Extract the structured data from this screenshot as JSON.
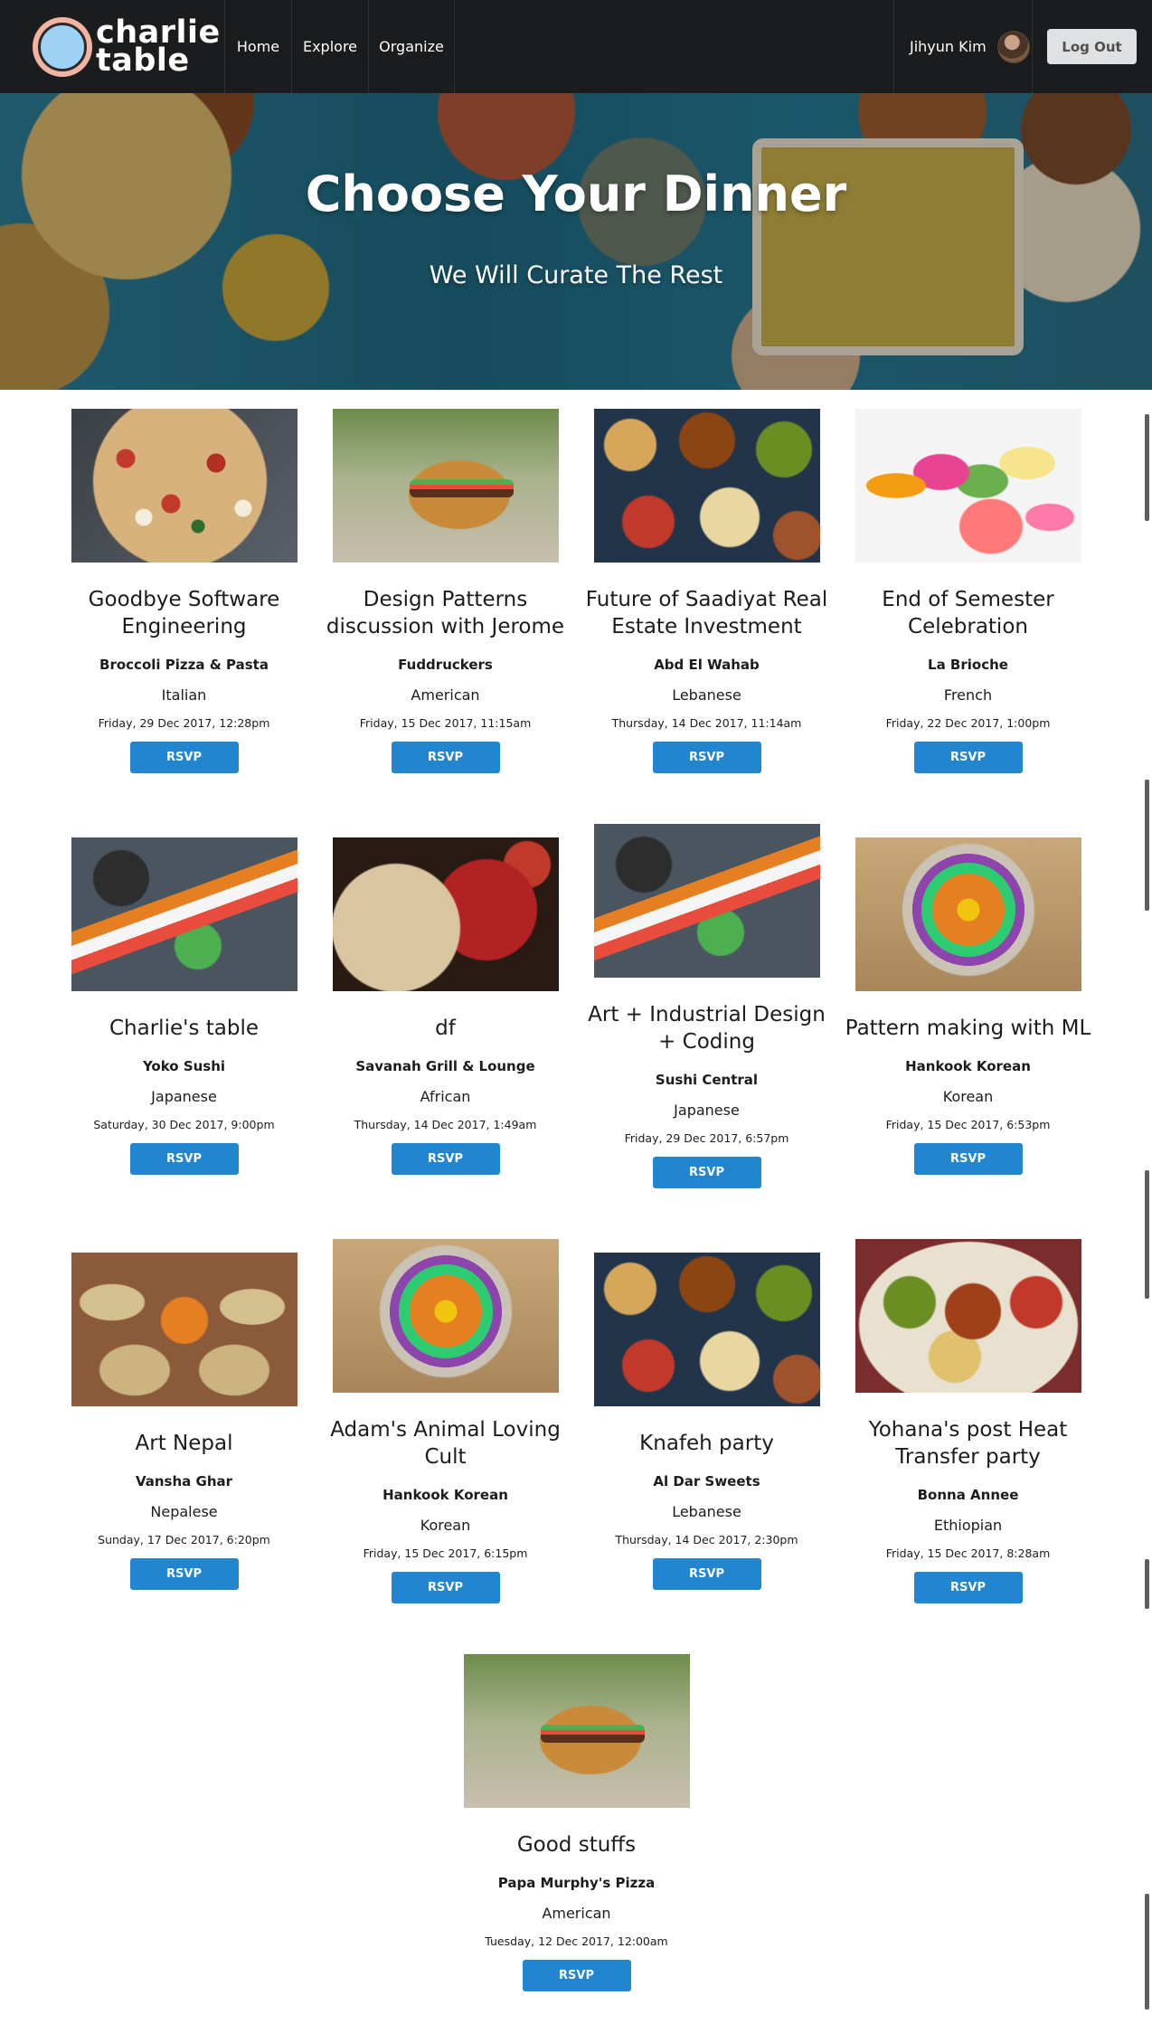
{
  "nav": {
    "logo_line1": "charlie",
    "logo_line2": "table",
    "items": [
      "Home",
      "Explore",
      "Organize"
    ],
    "user_name": "Jihyun Kim",
    "logout_label": "Log Out"
  },
  "hero": {
    "title": "Choose Your Dinner",
    "subtitle": "We Will Curate The Rest"
  },
  "accent_color": "#2185d0",
  "events": [
    {
      "title": "Goodbye Software Engineering",
      "restaurant": "Broccoli Pizza & Pasta",
      "cuisine": "Italian",
      "date": "Friday, 29 Dec 2017, 12:28pm",
      "rsvp": "RSVP",
      "image": "pizza"
    },
    {
      "title": "Design Patterns discussion with Jerome",
      "restaurant": "Fuddruckers",
      "cuisine": "American",
      "date": "Friday, 15 Dec 2017, 11:15am",
      "rsvp": "RSVP",
      "image": "burger"
    },
    {
      "title": "Future of Saadiyat Real Estate Investment",
      "restaurant": "Abd El Wahab",
      "cuisine": "Lebanese",
      "date": "Thursday, 14 Dec 2017, 11:14am",
      "rsvp": "RSVP",
      "image": "mezze"
    },
    {
      "title": "End of Semester Celebration",
      "restaurant": "La Brioche",
      "cuisine": "French",
      "date": "Friday, 22 Dec 2017, 1:00pm",
      "rsvp": "RSVP",
      "image": "macaron"
    },
    {
      "title": "Charlie's table",
      "restaurant": "Yoko Sushi",
      "cuisine": "Japanese",
      "date": "Saturday, 30 Dec 2017, 9:00pm",
      "rsvp": "RSVP",
      "image": "sushi"
    },
    {
      "title": "df",
      "restaurant": "Savanah Grill & Lounge",
      "cuisine": "African",
      "date": "Thursday, 14 Dec 2017, 1:49am",
      "rsvp": "RSVP",
      "image": "rice"
    },
    {
      "title": "Art + Industrial Design + Coding",
      "restaurant": "Sushi Central",
      "cuisine": "Japanese",
      "date": "Friday, 29 Dec 2017, 6:57pm",
      "rsvp": "RSVP",
      "image": "sushi"
    },
    {
      "title": "Pattern making with ML",
      "restaurant": "Hankook Korean",
      "cuisine": "Korean",
      "date": "Friday, 15 Dec 2017, 6:53pm",
      "rsvp": "RSVP",
      "image": "bibimbap"
    },
    {
      "title": "Art Nepal",
      "restaurant": "Vansha Ghar",
      "cuisine": "Nepalese",
      "date": "Sunday, 17 Dec 2017, 6:20pm",
      "rsvp": "RSVP",
      "image": "dumplings"
    },
    {
      "title": "Adam's Animal Loving Cult",
      "restaurant": "Hankook Korean",
      "cuisine": "Korean",
      "date": "Friday, 15 Dec 2017, 6:15pm",
      "rsvp": "RSVP",
      "image": "bibimbap"
    },
    {
      "title": "Knafeh party",
      "restaurant": "Al Dar Sweets",
      "cuisine": "Lebanese",
      "date": "Thursday, 14 Dec 2017, 2:30pm",
      "rsvp": "RSVP",
      "image": "mezze"
    },
    {
      "title": "Yohana's post Heat Transfer party",
      "restaurant": "Bonna Annee",
      "cuisine": "Ethiopian",
      "date": "Friday, 15 Dec 2017, 8:28am",
      "rsvp": "RSVP",
      "image": "injera"
    },
    {
      "title": "Good stuffs",
      "restaurant": "Papa Murphy's Pizza",
      "cuisine": "American",
      "date": "Tuesday, 12 Dec 2017, 12:00am",
      "rsvp": "RSVP",
      "image": "burger"
    }
  ]
}
